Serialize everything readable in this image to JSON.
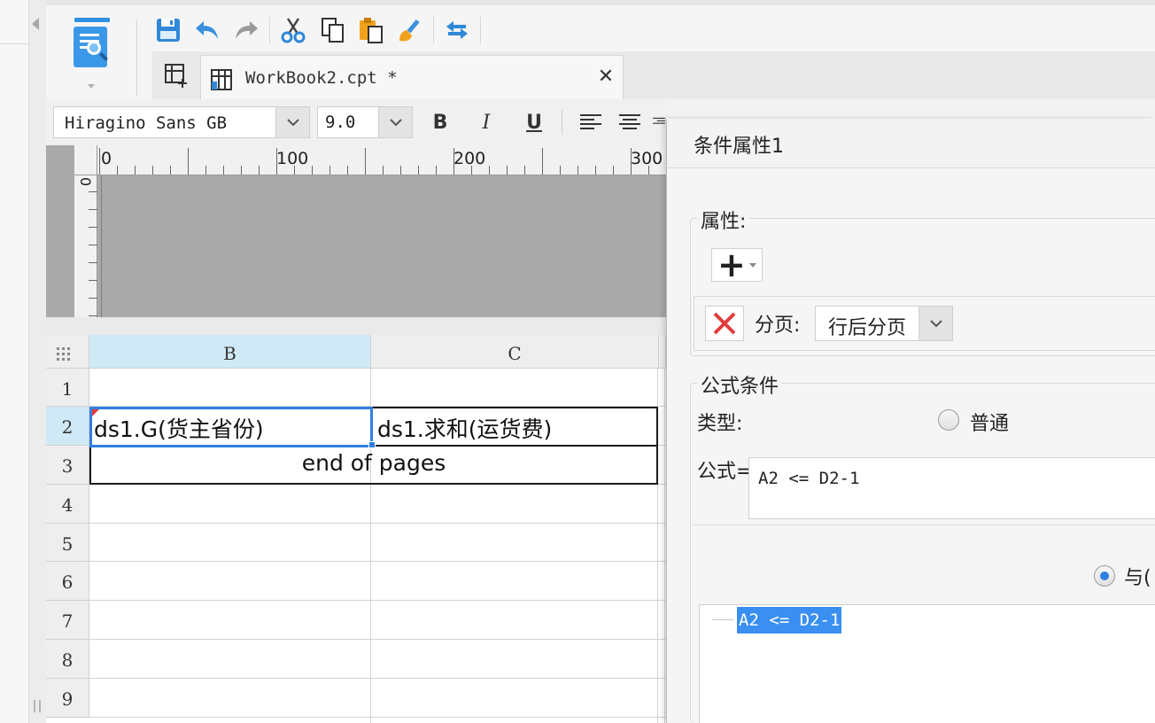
{
  "toolbar": {
    "icons": [
      "save-icon",
      "undo-icon",
      "redo-icon",
      "cut-icon",
      "copy-icon",
      "paste-icon",
      "format-brush-icon",
      "swap-icon"
    ]
  },
  "tabs": {
    "new_tab_icon": "new-report-icon",
    "active_tab_title": "WorkBook2.cpt *",
    "close_glyph": "✕"
  },
  "format": {
    "font_family": "Hiragino Sans GB",
    "font_size": "9.0",
    "bold": "B",
    "italic": "I",
    "underline": "U"
  },
  "ruler": {
    "h_labels": [
      "0",
      "100",
      "200",
      "300"
    ],
    "v_label": "0"
  },
  "sheet": {
    "columns": [
      "B",
      "C"
    ],
    "rows": [
      "1",
      "2",
      "3",
      "4",
      "5",
      "6",
      "7",
      "8",
      "9"
    ],
    "selected_column": "B",
    "selected_row": "2",
    "cells": {
      "B2": "ds1.G(货主省份)",
      "C2": "ds1.求和(运货费)",
      "B3": "end of pages"
    }
  },
  "dialog": {
    "title": "条件属性1",
    "properties_label": "属性:",
    "add_glyph": "+",
    "page_break_label": "分页:",
    "page_break_value": "行后分页",
    "formula_condition_label": "公式条件",
    "type_label": "类型:",
    "type_option_normal": "普通",
    "formula_label": "公式=",
    "formula_value": "A2 <= D2-1",
    "join_option_and": "与(",
    "tree_item": "A2 <= D2-1"
  },
  "colors": {
    "accent": "#2f7fe2",
    "selection_highlight": "#3a8ff0",
    "header_selected": "#cfeaf6",
    "delete_red": "#e23c3c"
  }
}
